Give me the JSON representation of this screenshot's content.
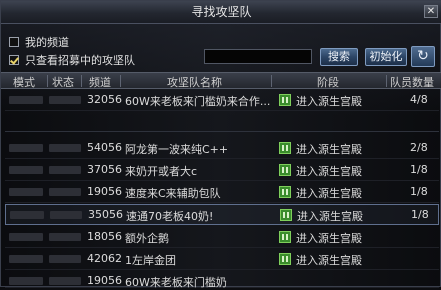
{
  "window": {
    "title": "寻找攻坚队",
    "close": "✕"
  },
  "options": {
    "my_channel": {
      "label": "我的频道",
      "checked": false
    },
    "recruiting_only": {
      "label": "只查看招募中的攻坚队",
      "checked": true
    }
  },
  "search": {
    "placeholder": "",
    "value": ""
  },
  "buttons": {
    "search": "搜索",
    "reset": "初始化",
    "refresh": "↻"
  },
  "columns": [
    "模式",
    "状态",
    "频道",
    "攻坚队名称",
    "阶段",
    "队员数量"
  ],
  "rows": [
    {
      "channel": "32056",
      "name": "60W来老板来门槛奶来合作...",
      "stage": "进入源生宫殿",
      "members": "4/8",
      "selected": false
    },
    {
      "channel": "",
      "name": "",
      "stage": "",
      "members": "",
      "selected": false
    },
    {
      "channel": "54056",
      "name": "阿龙第一波来纯C++",
      "stage": "进入源生宫殿",
      "members": "2/8",
      "selected": false
    },
    {
      "channel": "37056",
      "name": "来奶开或者大c",
      "stage": "进入源生宫殿",
      "members": "1/8",
      "selected": false
    },
    {
      "channel": "19056",
      "name": "速度来C来辅助包队",
      "stage": "进入源生宫殿",
      "members": "1/8",
      "selected": false
    },
    {
      "channel": "35056",
      "name": "速通70老板40奶!",
      "stage": "进入源生宫殿",
      "members": "1/8",
      "selected": true
    },
    {
      "channel": "18056",
      "name": "额外企鹅",
      "stage": "进入源生宫殿",
      "members": "",
      "selected": false
    },
    {
      "channel": "42062",
      "name": "1左岸金团",
      "stage": "进入源生宫殿",
      "members": "",
      "selected": false
    },
    {
      "channel": "19056",
      "name": "60W来老板来门槛奶",
      "stage": "",
      "members": "",
      "selected": false
    }
  ],
  "colors": {
    "accent_button": "#2c4566",
    "stage_icon": "#3a8c2c"
  }
}
